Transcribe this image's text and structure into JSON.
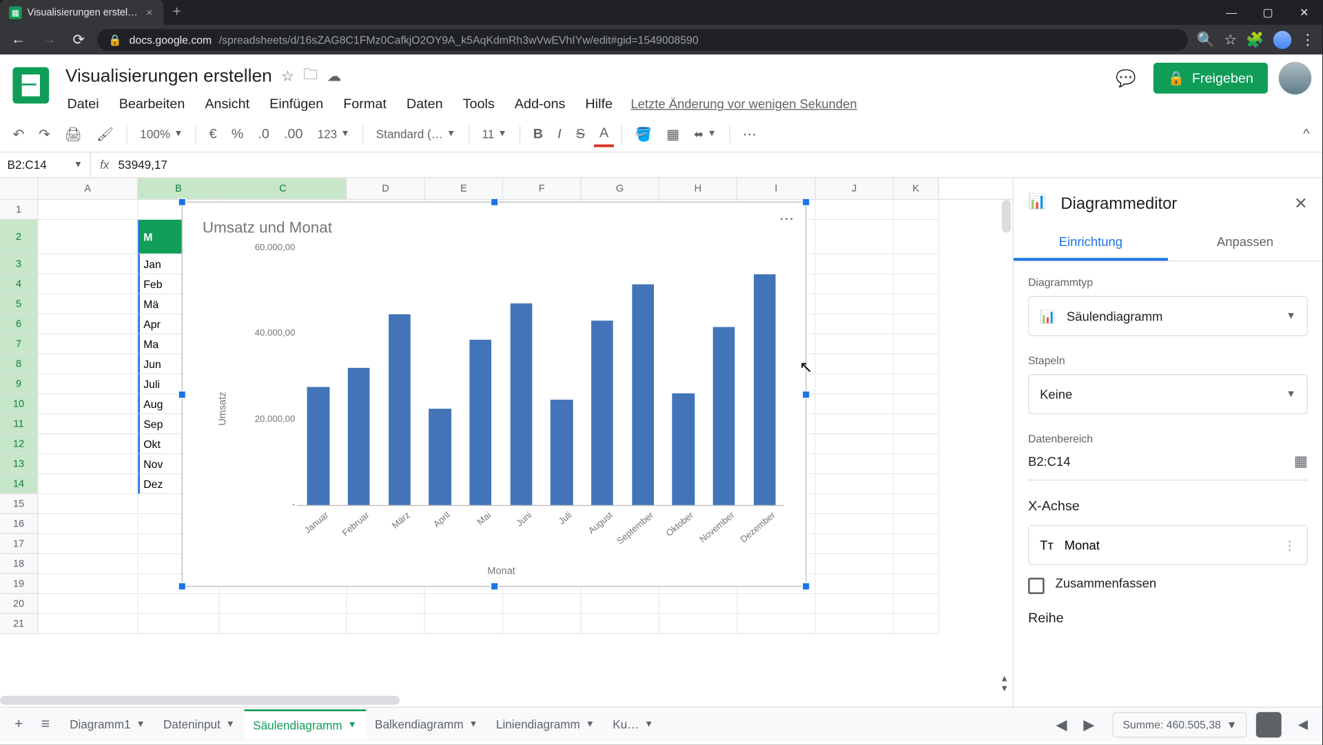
{
  "browser": {
    "tab_title": "Visualisierungen erstellen - Goo…",
    "url_host": "docs.google.com",
    "url_path": "/spreadsheets/d/16sZAG8C1FMz0CafkjO2OY9A_k5AqKdmRh3wVwEVhIYw/edit#gid=1549008590"
  },
  "doc": {
    "title": "Visualisierungen erstellen",
    "last_edit": "Letzte Änderung vor wenigen Sekunden",
    "menu": {
      "file": "Datei",
      "edit": "Bearbeiten",
      "view": "Ansicht",
      "insert": "Einfügen",
      "format": "Format",
      "data": "Daten",
      "tools": "Tools",
      "addons": "Add-ons",
      "help": "Hilfe"
    },
    "share": "Freigeben"
  },
  "toolbar": {
    "zoom": "100%",
    "font": "Standard (…",
    "size": "11",
    "format_num": "123"
  },
  "fx": {
    "range": "B2:C14",
    "value": "53949,17"
  },
  "cols": {
    "a": "A",
    "b": "B",
    "c": "C",
    "d": "D",
    "e": "E",
    "f": "F",
    "g": "G",
    "h": "H",
    "i": "I",
    "j": "J",
    "k": "K"
  },
  "row_nums": [
    "1",
    "2",
    "3",
    "4",
    "5",
    "6",
    "7",
    "8",
    "9",
    "10",
    "11",
    "12",
    "13",
    "14",
    "15",
    "16",
    "17",
    "18",
    "19",
    "20",
    "21"
  ],
  "sheet": {
    "header_b": "M",
    "months_short": [
      "Jan",
      "Feb",
      "Mä",
      "Apr",
      "Ma",
      "Jun",
      "Juli",
      "Aug",
      "Sep",
      "Okt",
      "Nov",
      "Dez"
    ]
  },
  "chart_data": {
    "type": "bar",
    "title": "Umsatz und Monat",
    "xlabel": "Monat",
    "ylabel": "Umsatz",
    "ylim": [
      0,
      60000
    ],
    "yticks": [
      "-",
      "20.000,00",
      "40.000,00",
      "60.000,00"
    ],
    "categories": [
      "Januar",
      "Februar",
      "März",
      "April",
      "Mai",
      "Juni",
      "Juli",
      "August",
      "September",
      "Oktober",
      "November",
      "Dezember"
    ],
    "values": [
      27500,
      32000,
      44500,
      22500,
      38500,
      47000,
      24500,
      43000,
      51500,
      26000,
      41500,
      53949
    ]
  },
  "editor": {
    "title": "Diagrammeditor",
    "tab_setup": "Einrichtung",
    "tab_customize": "Anpassen",
    "chart_type_label": "Diagrammtyp",
    "chart_type_value": "Säulendiagramm",
    "stacking_label": "Stapeln",
    "stacking_value": "Keine",
    "range_label": "Datenbereich",
    "range_value": "B2:C14",
    "xaxis_label": "X-Achse",
    "xaxis_value": "Monat",
    "aggregate": "Zusammenfassen",
    "series_label": "Reihe"
  },
  "sheets": {
    "add": "+",
    "menu": "≡",
    "tabs": [
      {
        "label": "Diagramm1"
      },
      {
        "label": "Dateninput"
      },
      {
        "label": "Säulendiagramm",
        "active": true
      },
      {
        "label": "Balkendiagramm"
      },
      {
        "label": "Liniendiagramm"
      },
      {
        "label": "Ku…"
      }
    ],
    "sum": "Summe: 460.505,38"
  }
}
